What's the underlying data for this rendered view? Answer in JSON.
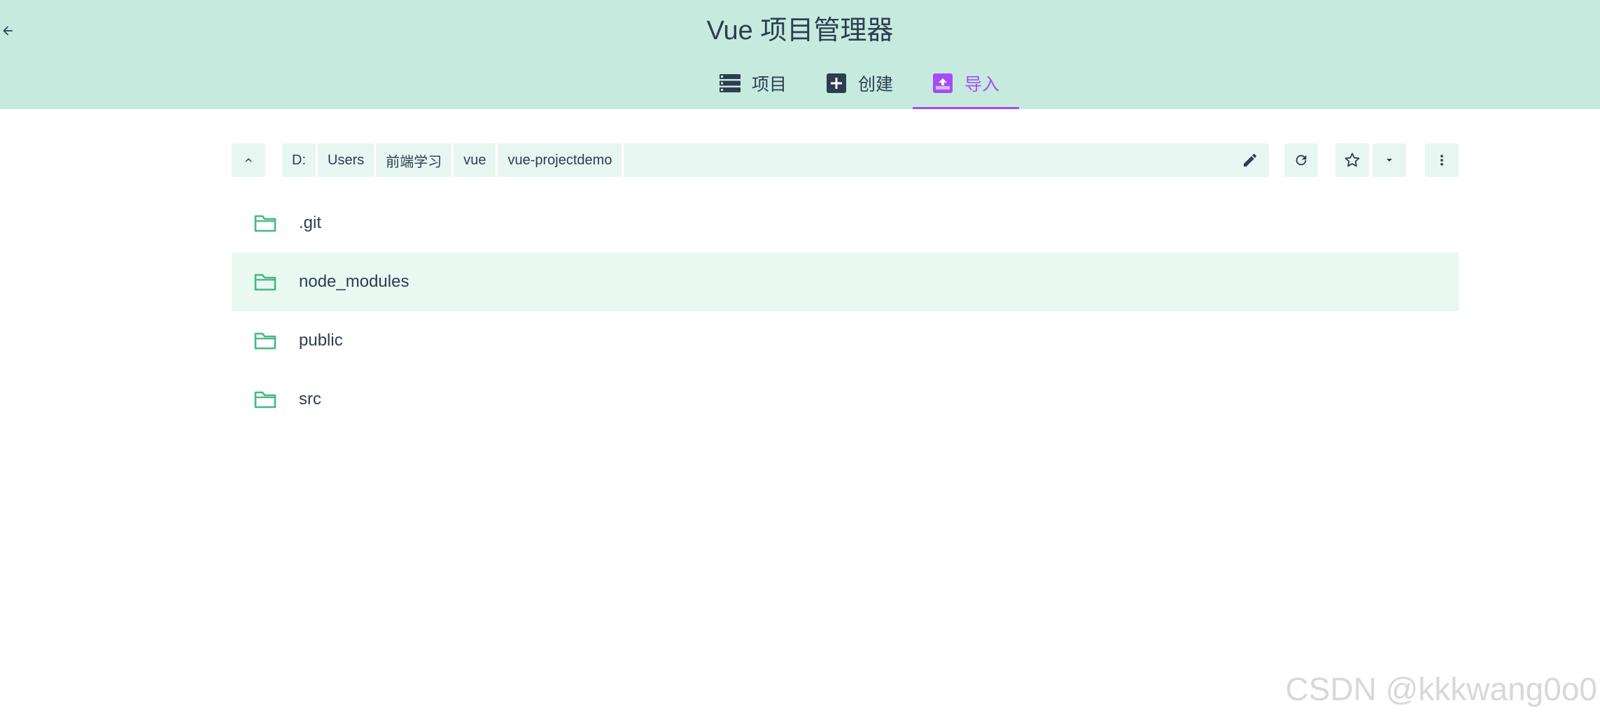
{
  "header": {
    "title": "Vue 项目管理器",
    "back_icon": "arrow-left-icon",
    "tabs": [
      {
        "label": "项目",
        "icon": "list-icon",
        "active": false
      },
      {
        "label": "创建",
        "icon": "add-box-icon",
        "active": false
      },
      {
        "label": "导入",
        "icon": "unarchive-icon",
        "active": true
      }
    ]
  },
  "toolbar": {
    "up_icon": "chevron-up-icon",
    "breadcrumb": [
      "D:",
      "Users",
      "前端学习",
      "vue",
      "vue-projectdemo"
    ],
    "edit_icon": "pencil-icon",
    "refresh_icon": "refresh-icon",
    "favorite_icon": "star-outline-icon",
    "favorites_dropdown_icon": "caret-down-icon",
    "more_icon": "more-vert-icon"
  },
  "folders": [
    {
      "name": ".git",
      "icon": "folder-outline-icon",
      "highlighted": false
    },
    {
      "name": "node_modules",
      "icon": "folder-outline-icon",
      "highlighted": true
    },
    {
      "name": "public",
      "icon": "folder-outline-icon",
      "highlighted": false
    },
    {
      "name": "src",
      "icon": "folder-outline-icon",
      "highlighted": false
    }
  ],
  "watermark": "CSDN @kkkwang0o0",
  "colors": {
    "header_bg": "#c6ebde",
    "accent": "#a44cf6",
    "text": "#2c3e50",
    "folder_icon": "#42b983",
    "toolbar_bg": "#e7f6f0",
    "row_highlight": "#eaf8f2"
  }
}
